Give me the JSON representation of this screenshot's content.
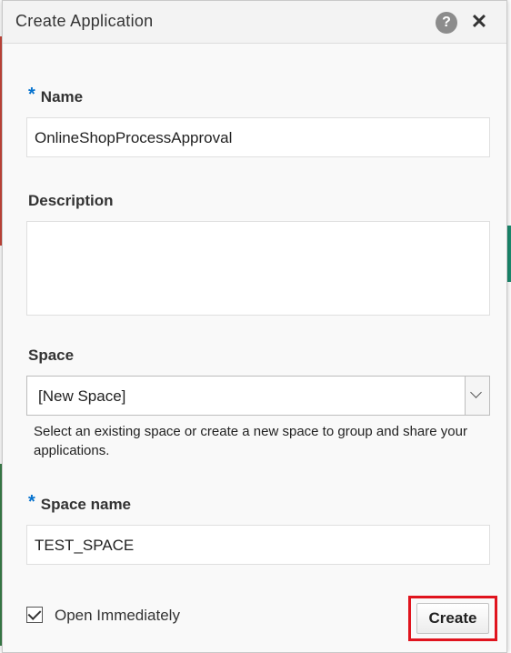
{
  "dialog": {
    "title": "Create Application",
    "help_icon": "question-circle-icon",
    "close_icon": "close-icon"
  },
  "form": {
    "name": {
      "required_marker": "*",
      "label": "Name",
      "value": "OnlineShopProcessApproval"
    },
    "description": {
      "label": "Description",
      "value": ""
    },
    "space": {
      "label": "Space",
      "selected": "[New Space]",
      "help": "Select an existing space or create a new space to group and share your applications."
    },
    "space_name": {
      "required_marker": "*",
      "label": "Space name",
      "value": "TEST_SPACE"
    },
    "open_immediately": {
      "label": "Open Immediately",
      "checked": true
    },
    "create_label": "Create"
  },
  "colors": {
    "required": "#0572ce",
    "highlight": "#e0141e"
  }
}
